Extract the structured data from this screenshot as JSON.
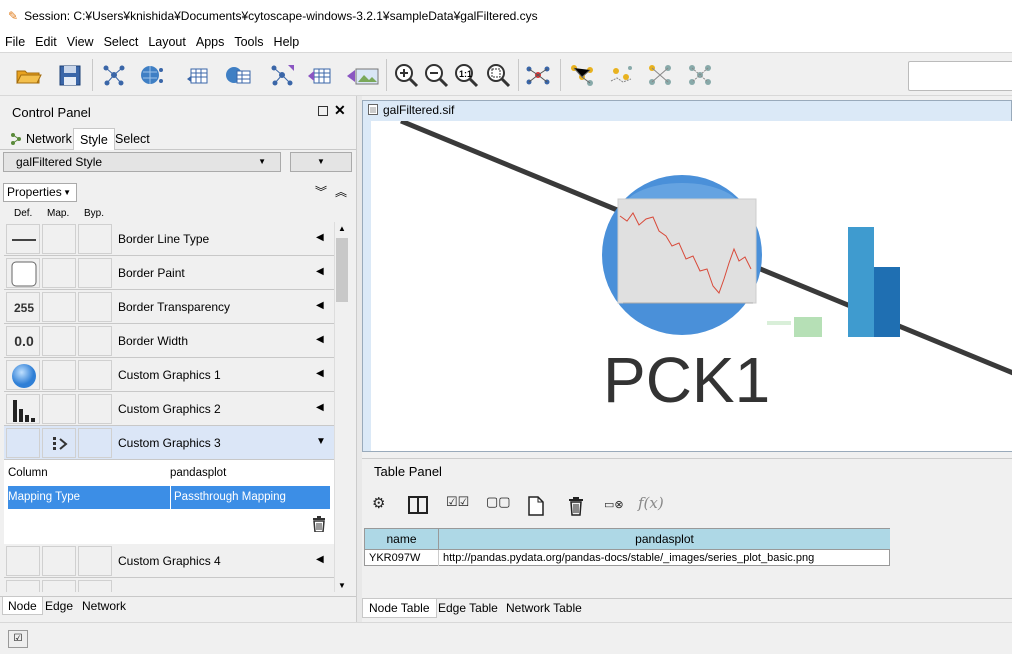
{
  "window": {
    "title": "Session: C:¥Users¥knishida¥Documents¥cytoscape-windows-3.2.1¥sampleData¥galFiltered.cys"
  },
  "menu": [
    "File",
    "Edit",
    "View",
    "Select",
    "Layout",
    "Apps",
    "Tools",
    "Help"
  ],
  "control_panel": {
    "title": "Control Panel",
    "tabs": [
      "Network",
      "Style",
      "Select"
    ],
    "selected_tab": "Style",
    "style_name": "galFiltered Style",
    "properties_label": "Properties",
    "col_headers": {
      "def": "Def.",
      "map": "Map.",
      "byp": "Byp."
    },
    "rows": [
      {
        "label": "Border Line Type",
        "def_icon": "line-icon"
      },
      {
        "label": "Border Paint",
        "def_icon": "white-swatch-icon"
      },
      {
        "label": "Border Transparency",
        "def_text": "255"
      },
      {
        "label": "Border Width",
        "def_text": "0.0"
      },
      {
        "label": "Custom Graphics 1",
        "def_icon": "blue-circle-icon"
      },
      {
        "label": "Custom Graphics 2",
        "def_icon": "bar-chart-icon"
      },
      {
        "label": "Custom Graphics 3",
        "map_icon": "passthrough-icon"
      },
      {
        "label": "Custom Graphics 4"
      }
    ],
    "expanded_detail": {
      "column_label": "Column",
      "column_value": "pandasplot",
      "mapping_label": "Mapping Type",
      "mapping_value": "Passthrough Mapping"
    },
    "bottom_tabs": [
      "Node",
      "Edge",
      "Network"
    ]
  },
  "network_view": {
    "title": "galFiltered.sif",
    "node_label": "PCK1",
    "colors": {
      "node_fill": "#4a90d9",
      "bar_dark": "#1f6fb2",
      "bar_mid": "#3f9bcf",
      "bar_light": "#b6e0b6",
      "edge": "#3a3a3a"
    }
  },
  "table_panel": {
    "title": "Table Panel",
    "columns": [
      "name",
      "pandasplot"
    ],
    "rows": [
      [
        "YKR097W",
        "http://pandas.pydata.org/pandas-docs/stable/_images/series_plot_basic.png"
      ]
    ],
    "tabs": [
      "Node Table",
      "Edge Table",
      "Network Table"
    ],
    "fx_label": "f(x)"
  }
}
